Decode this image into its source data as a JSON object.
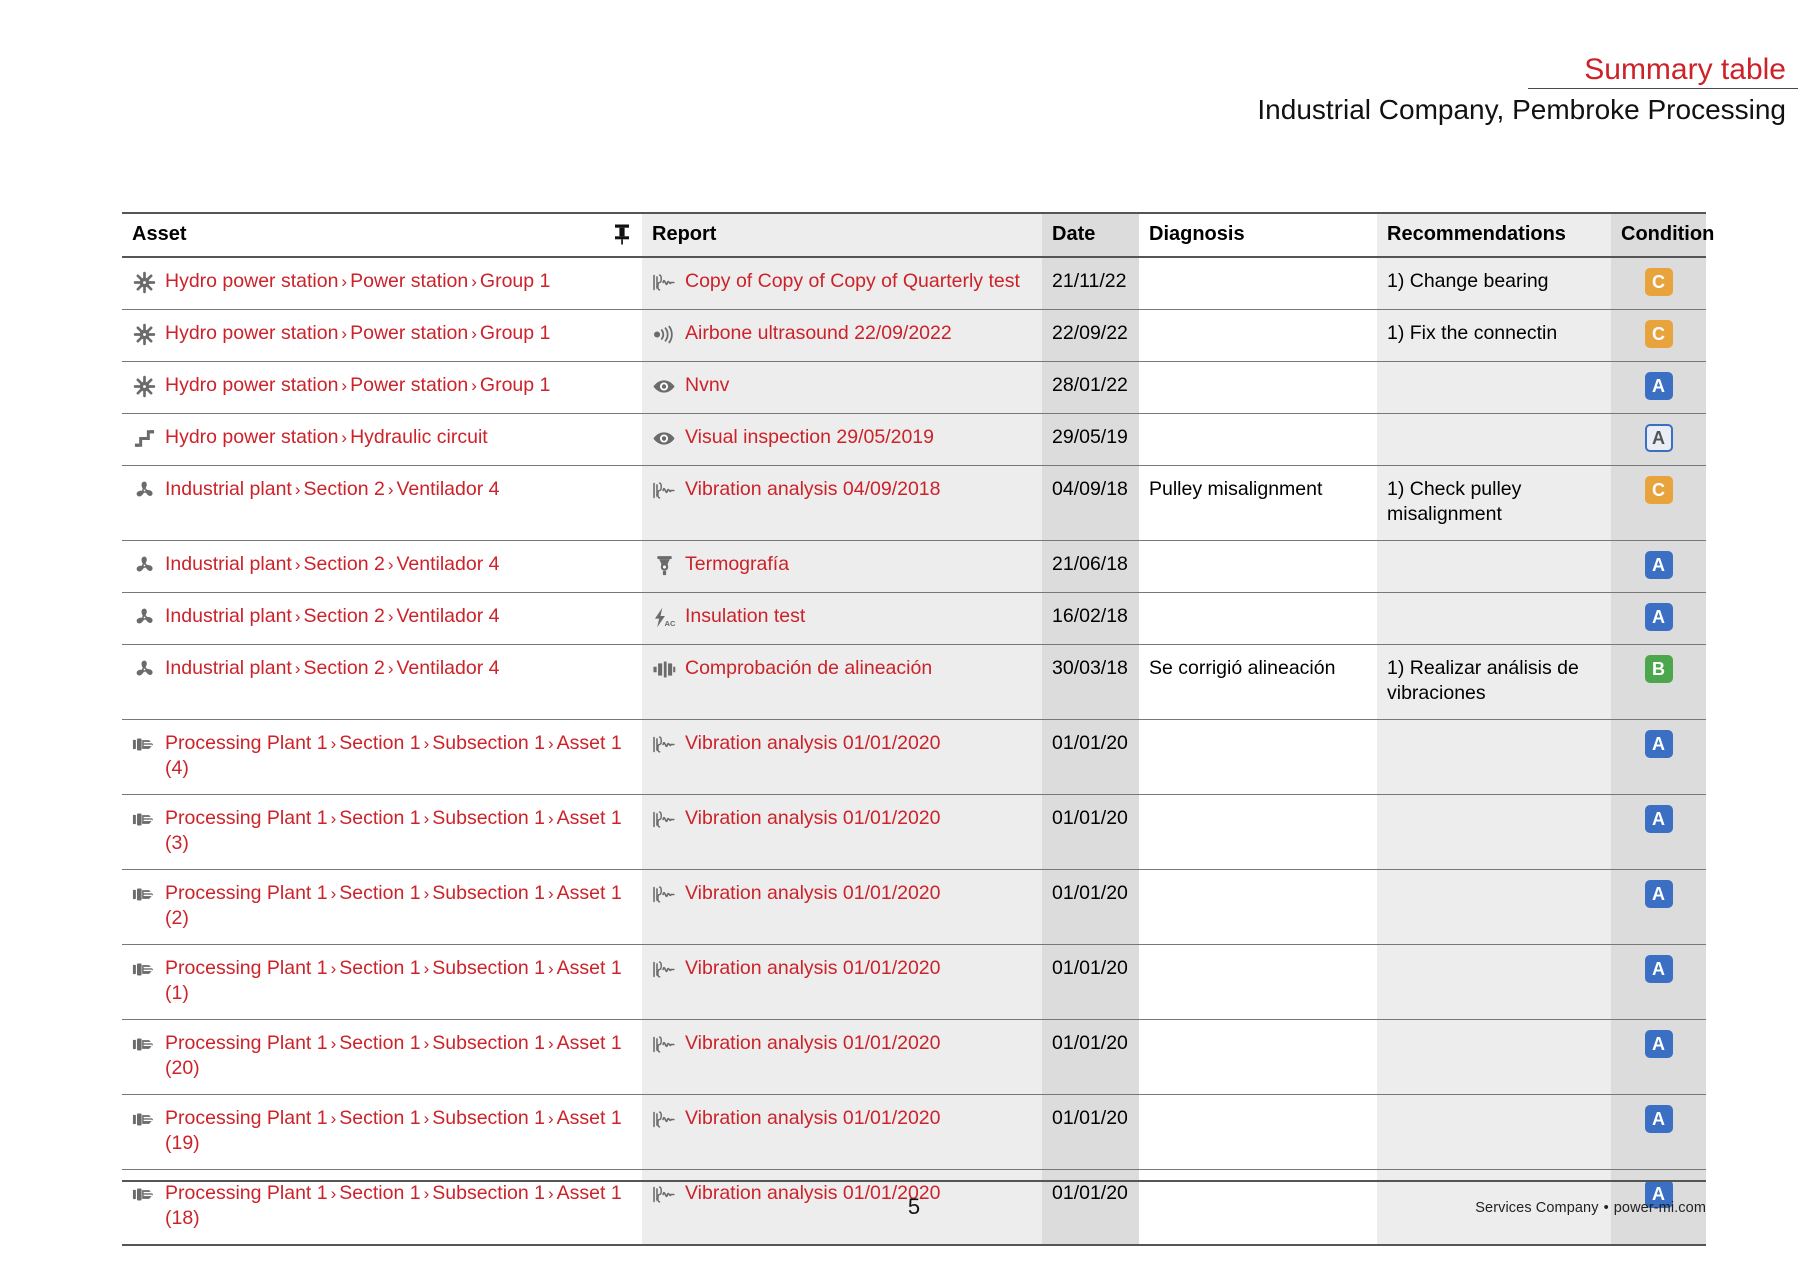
{
  "header": {
    "title": "Summary table",
    "subtitle": "Industrial Company, Pembroke Processing",
    "title_color": "#cc2229"
  },
  "table": {
    "columns": [
      {
        "key": "asset",
        "label": "Asset",
        "icon": "pin-icon"
      },
      {
        "key": "report",
        "label": "Report"
      },
      {
        "key": "date",
        "label": "Date"
      },
      {
        "key": "diagnosis",
        "label": "Diagnosis"
      },
      {
        "key": "recommendations",
        "label": "Recommendations"
      },
      {
        "key": "condition",
        "label": "Condition"
      }
    ],
    "rows": [
      {
        "asset_icon": "gear-asterisk-icon",
        "asset_path": [
          "Hydro power station",
          "Power station",
          "Group 1"
        ],
        "report_icon": "vibration-waveform-icon",
        "report": "Copy of Copy of Copy of Quarterly test",
        "date": "21/11/22",
        "diagnosis": "",
        "recommendations": "1) Change bearing",
        "condition": "C",
        "condition_style": "solid",
        "condition_color": "#e8a33d"
      },
      {
        "asset_icon": "gear-asterisk-icon",
        "asset_path": [
          "Hydro power station",
          "Power station",
          "Group 1"
        ],
        "report_icon": "ultrasound-icon",
        "report": "Airbone ultrasound 22/09/2022",
        "date": "22/09/22",
        "diagnosis": "",
        "recommendations": "1) Fix the connectin",
        "condition": "C",
        "condition_style": "solid",
        "condition_color": "#e8a33d"
      },
      {
        "asset_icon": "gear-asterisk-icon",
        "asset_path": [
          "Hydro power station",
          "Power station",
          "Group 1"
        ],
        "report_icon": "eye-icon",
        "report": "Nvnv",
        "date": "28/01/22",
        "diagnosis": "",
        "recommendations": "",
        "condition": "A",
        "condition_style": "solid",
        "condition_color": "#3a6fc4"
      },
      {
        "asset_icon": "hydraulic-circuit-icon",
        "asset_path": [
          "Hydro power station",
          "Hydraulic circuit"
        ],
        "report_icon": "eye-icon",
        "report": "Visual inspection 29/05/2019",
        "date": "29/05/19",
        "diagnosis": "",
        "recommendations": "",
        "condition": "A",
        "condition_style": "outline",
        "condition_color": "#3a6fc4"
      },
      {
        "asset_icon": "fan-icon",
        "asset_path": [
          "Industrial plant",
          "Section 2",
          "Ventilador 4"
        ],
        "report_icon": "vibration-waveform-icon",
        "report": "Vibration analysis 04/09/2018",
        "date": "04/09/18",
        "diagnosis": "Pulley misalignment",
        "recommendations": "1) Check pulley misalignment",
        "condition": "C",
        "condition_style": "solid",
        "condition_color": "#e8a33d"
      },
      {
        "asset_icon": "fan-icon",
        "asset_path": [
          "Industrial plant",
          "Section 2",
          "Ventilador 4"
        ],
        "report_icon": "thermal-camera-icon",
        "report": "Termografía",
        "date": "21/06/18",
        "diagnosis": "",
        "recommendations": "",
        "condition": "A",
        "condition_style": "solid",
        "condition_color": "#3a6fc4"
      },
      {
        "asset_icon": "fan-icon",
        "asset_path": [
          "Industrial plant",
          "Section 2",
          "Ventilador 4"
        ],
        "report_icon": "insulation-bolt-ac-icon",
        "report": "Insulation test",
        "date": "16/02/18",
        "diagnosis": "",
        "recommendations": "",
        "condition": "A",
        "condition_style": "solid",
        "condition_color": "#3a6fc4"
      },
      {
        "asset_icon": "fan-icon",
        "asset_path": [
          "Industrial plant",
          "Section 2",
          "Ventilador 4"
        ],
        "report_icon": "alignment-bars-icon",
        "report": "Comprobación de alineación",
        "date": "30/03/18",
        "diagnosis": "Se corrigió alineación",
        "recommendations": "1) Realizar análisis de vibraciones",
        "condition": "B",
        "condition_style": "solid",
        "condition_color": "#4ca64c"
      },
      {
        "asset_icon": "motor-icon",
        "asset_path": [
          "Processing Plant 1",
          "Section 1",
          "Subsection 1",
          "Asset 1 (4)"
        ],
        "report_icon": "vibration-waveform-icon",
        "report": "Vibration analysis 01/01/2020",
        "date": "01/01/20",
        "diagnosis": "",
        "recommendations": "",
        "condition": "A",
        "condition_style": "solid",
        "condition_color": "#3a6fc4"
      },
      {
        "asset_icon": "motor-icon",
        "asset_path": [
          "Processing Plant 1",
          "Section 1",
          "Subsection 1",
          "Asset 1 (3)"
        ],
        "report_icon": "vibration-waveform-icon",
        "report": "Vibration analysis 01/01/2020",
        "date": "01/01/20",
        "diagnosis": "",
        "recommendations": "",
        "condition": "A",
        "condition_style": "solid",
        "condition_color": "#3a6fc4"
      },
      {
        "asset_icon": "motor-icon",
        "asset_path": [
          "Processing Plant 1",
          "Section 1",
          "Subsection 1",
          "Asset 1 (2)"
        ],
        "report_icon": "vibration-waveform-icon",
        "report": "Vibration analysis 01/01/2020",
        "date": "01/01/20",
        "diagnosis": "",
        "recommendations": "",
        "condition": "A",
        "condition_style": "solid",
        "condition_color": "#3a6fc4"
      },
      {
        "asset_icon": "motor-icon",
        "asset_path": [
          "Processing Plant 1",
          "Section 1",
          "Subsection 1",
          "Asset 1 (1)"
        ],
        "report_icon": "vibration-waveform-icon",
        "report": "Vibration analysis 01/01/2020",
        "date": "01/01/20",
        "diagnosis": "",
        "recommendations": "",
        "condition": "A",
        "condition_style": "solid",
        "condition_color": "#3a6fc4"
      },
      {
        "asset_icon": "motor-icon",
        "asset_path": [
          "Processing Plant 1",
          "Section 1",
          "Subsection 1",
          "Asset 1 (20)"
        ],
        "report_icon": "vibration-waveform-icon",
        "report": "Vibration analysis 01/01/2020",
        "date": "01/01/20",
        "diagnosis": "",
        "recommendations": "",
        "condition": "A",
        "condition_style": "solid",
        "condition_color": "#3a6fc4"
      },
      {
        "asset_icon": "motor-icon",
        "asset_path": [
          "Processing Plant 1",
          "Section 1",
          "Subsection 1",
          "Asset 1 (19)"
        ],
        "report_icon": "vibration-waveform-icon",
        "report": "Vibration analysis 01/01/2020",
        "date": "01/01/20",
        "diagnosis": "",
        "recommendations": "",
        "condition": "A",
        "condition_style": "solid",
        "condition_color": "#3a6fc4"
      },
      {
        "asset_icon": "motor-icon",
        "asset_path": [
          "Processing Plant 1",
          "Section 1",
          "Subsection 1",
          "Asset 1 (18)"
        ],
        "report_icon": "vibration-waveform-icon",
        "report": "Vibration analysis 01/01/2020",
        "date": "01/01/20",
        "diagnosis": "",
        "recommendations": "",
        "condition": "A",
        "condition_style": "solid",
        "condition_color": "#3a6fc4"
      }
    ]
  },
  "footer": {
    "page_number": "5",
    "company": "Services Company",
    "separator": "•",
    "site": "power-mi.com"
  }
}
